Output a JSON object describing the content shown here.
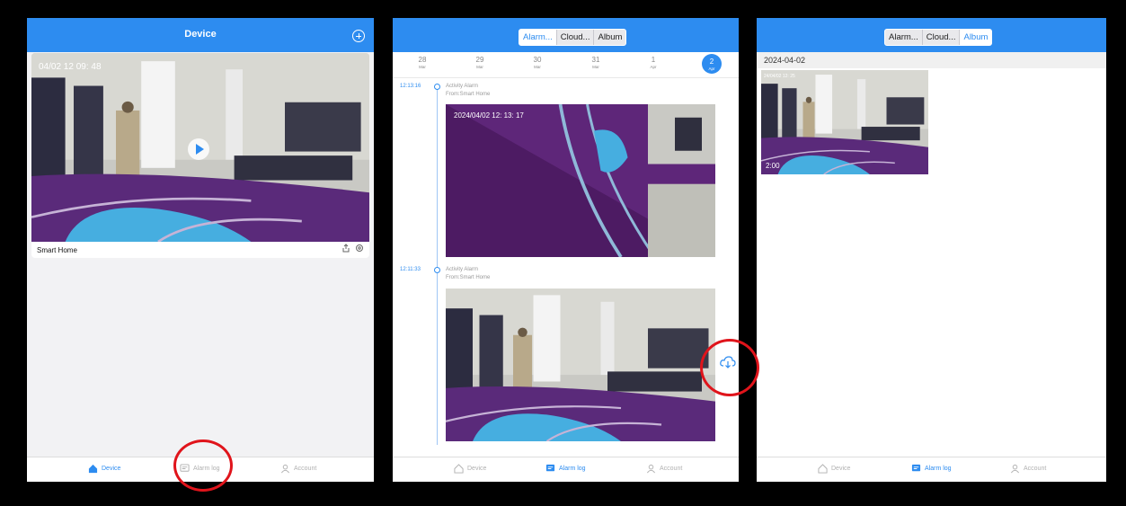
{
  "screen1": {
    "header_title": "Device",
    "add_icon": "plus-circle-icon",
    "camera_timestamp": "04/02 12 09: 48",
    "device_name": "Smart Home",
    "tabs": [
      {
        "label": "Device",
        "icon": "house-icon",
        "active": true
      },
      {
        "label": "Alarm log",
        "icon": "message-icon",
        "active": false
      },
      {
        "label": "Account",
        "icon": "person-icon",
        "active": false
      }
    ]
  },
  "screen2": {
    "segments": [
      "Alarm...",
      "Cloud...",
      "Album"
    ],
    "active_segment": 0,
    "dates": [
      {
        "day": "28",
        "month": "Mar"
      },
      {
        "day": "29",
        "month": "Mar"
      },
      {
        "day": "30",
        "month": "Mar"
      },
      {
        "day": "31",
        "month": "Mar"
      },
      {
        "day": "1",
        "month": "Apr"
      },
      {
        "day": "2",
        "month": "Apr",
        "selected": true
      }
    ],
    "events": [
      {
        "time": "12:13:16",
        "title": "Activity Alarm",
        "from": "From:Smart Home",
        "overlay": "2024/04/02  12: 13: 17"
      },
      {
        "time": "12:11:33",
        "title": "Activity Alarm",
        "from": "From:Smart Home"
      }
    ],
    "tabs": [
      {
        "label": "Device",
        "icon": "house-icon",
        "active": false
      },
      {
        "label": "Alarm log",
        "icon": "message-icon",
        "active": true
      },
      {
        "label": "Account",
        "icon": "person-icon",
        "active": false
      }
    ]
  },
  "screen3": {
    "segments": [
      "Alarm...",
      "Cloud...",
      "Album"
    ],
    "active_segment": 2,
    "date_header": "2024-04-02",
    "thumb_stamp": "24/04/02 12: 25",
    "thumb_duration": "2:00",
    "tabs": [
      {
        "label": "Device",
        "icon": "house-icon",
        "active": false
      },
      {
        "label": "Alarm log",
        "icon": "message-icon",
        "active": true
      },
      {
        "label": "Account",
        "icon": "person-icon",
        "active": false
      }
    ]
  },
  "colors": {
    "accent": "#2d8cf0",
    "highlight_ring": "#e0141b",
    "floor": "#5a2a7a"
  }
}
